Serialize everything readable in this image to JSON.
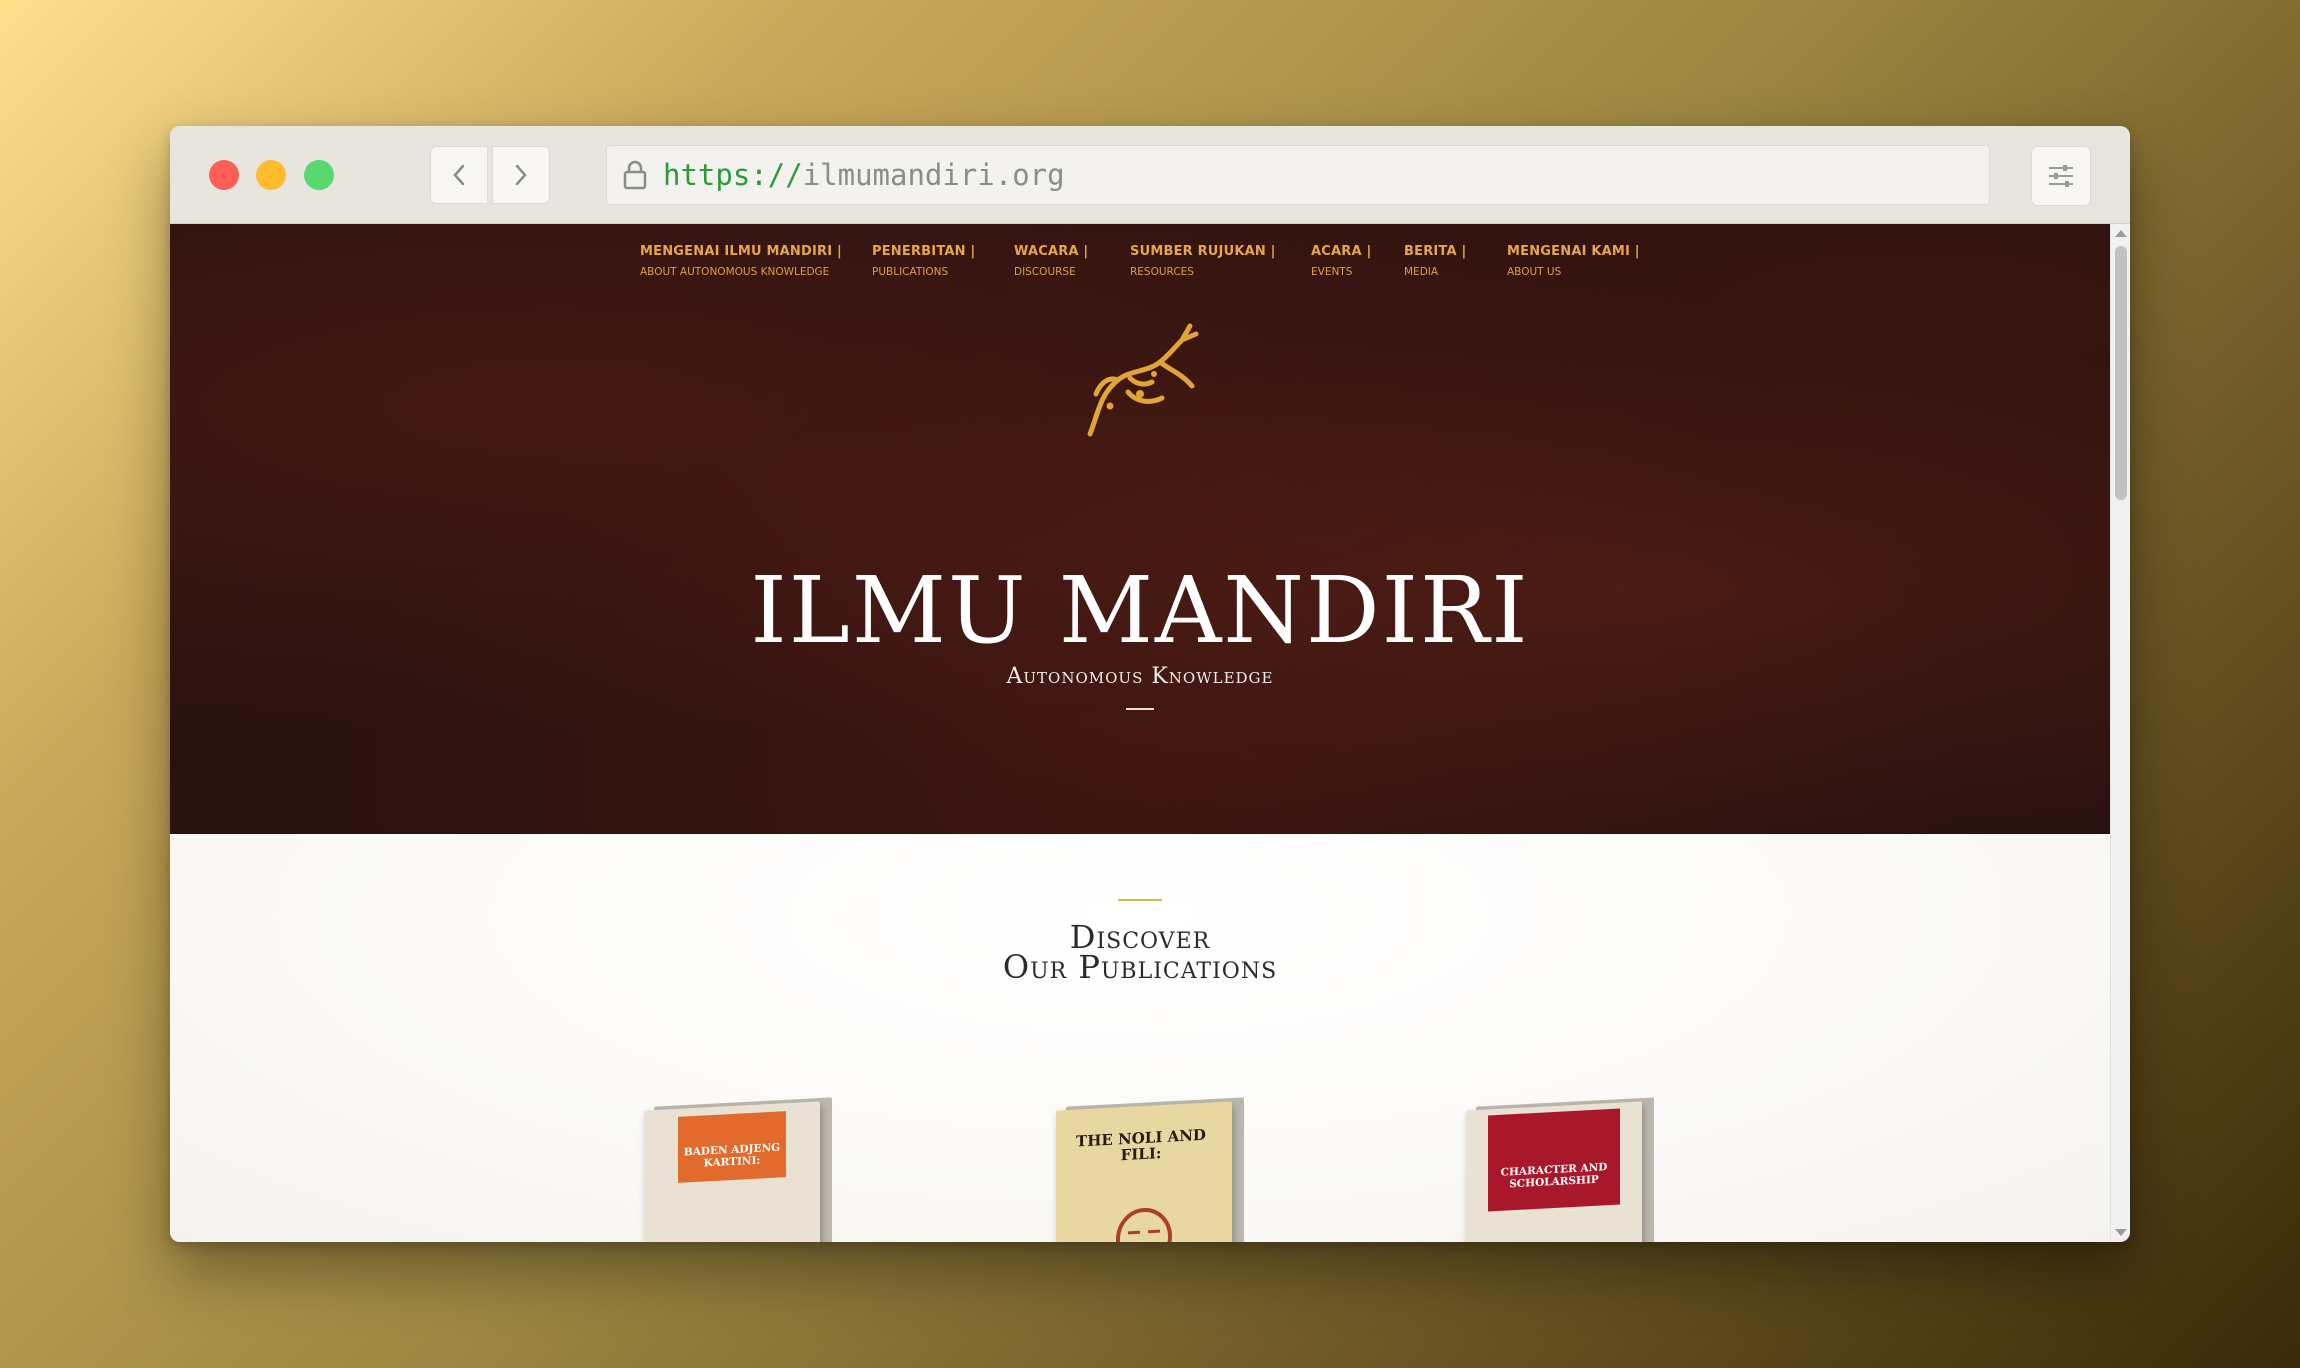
{
  "browser": {
    "url_scheme": "https://",
    "url_host": "ilmumandiri.org"
  },
  "nav": {
    "items": [
      {
        "main": "MENGENAI ILMU MANDIRI |",
        "sub": "ABOUT AUTONOMOUS KNOWLEDGE"
      },
      {
        "main": "PENERBITAN |",
        "sub": "PUBLICATIONS"
      },
      {
        "main": "WACARA |",
        "sub": "DISCOURSE"
      },
      {
        "main": "SUMBER RUJUKAN |",
        "sub": "RESOURCES"
      },
      {
        "main": "ACARA |",
        "sub": "EVENTS"
      },
      {
        "main": "BERITA |",
        "sub": "MEDIA"
      },
      {
        "main": "MENGENAI KAMI |",
        "sub": "ABOUT US"
      }
    ]
  },
  "hero": {
    "title": "ILMU MANDIRI",
    "subtitle": "Autonomous Knowledge"
  },
  "publications": {
    "title_line1": "Discover",
    "title_line2": "Our Publications",
    "books": [
      {
        "title": "BADEN ADJENG KARTINI:",
        "accent": "#e26a2c"
      },
      {
        "title": "THE NOLI AND FILI:",
        "accent": "#e8d7a0"
      },
      {
        "title": "CHARACTER AND SCHOLARSHIP",
        "accent": "#a8182a"
      }
    ]
  },
  "colors": {
    "hero_bg": "#2a1210",
    "nav_text": "#e6a64a",
    "gold_rule": "#d8b84a",
    "logo_gold": "#e0a437"
  }
}
